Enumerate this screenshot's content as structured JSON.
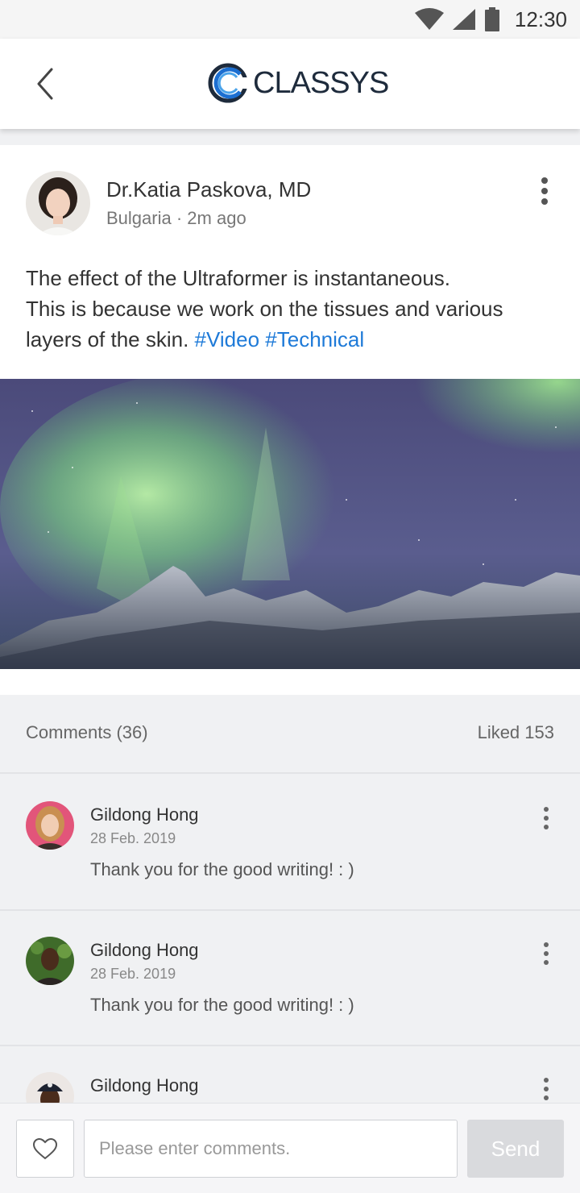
{
  "status_bar": {
    "time": "12:30",
    "icons": [
      "wifi-icon",
      "cell-signal-icon",
      "battery-icon"
    ]
  },
  "header": {
    "brand_name": "CLASSYS",
    "back_icon": "chevron-left-icon",
    "logo_icon": "classys-logo"
  },
  "post": {
    "author_name": "Dr.Katia Paskova, MD",
    "location": "Bulgaria",
    "separator": "·",
    "time_ago": "2m ago",
    "text_line_1": "The effect of the Ultraformer is instantaneous.",
    "text_line_2": "This is because we work on the tissues and various",
    "text_line_3_prefix": "layers of the skin.",
    "tags": [
      "#Video",
      "#Technical"
    ],
    "image_alt_icon": "aurora-mountain-photo",
    "menu_icon": "more-vertical-icon"
  },
  "comments_header": {
    "comments_label": "Comments (36)",
    "likes_label": "Liked 153"
  },
  "comments": [
    {
      "name": "Gildong Hong",
      "date": "28 Feb. 2019",
      "text": "Thank you for the good writing! : )"
    },
    {
      "name": "Gildong Hong",
      "date": "28 Feb. 2019",
      "text": "Thank you for the good writing! : )"
    },
    {
      "name": "Gildong Hong",
      "date": "",
      "text": ""
    }
  ],
  "composer": {
    "placeholder": "Please enter comments.",
    "value": "",
    "send_label": "Send",
    "like_icon": "heart-outline-icon"
  },
  "colors": {
    "accent_link": "#1e7ad8",
    "brand_dark": "#1e2b3c",
    "background": "#f0f1f3",
    "send_disabled": "#d9dadd"
  }
}
